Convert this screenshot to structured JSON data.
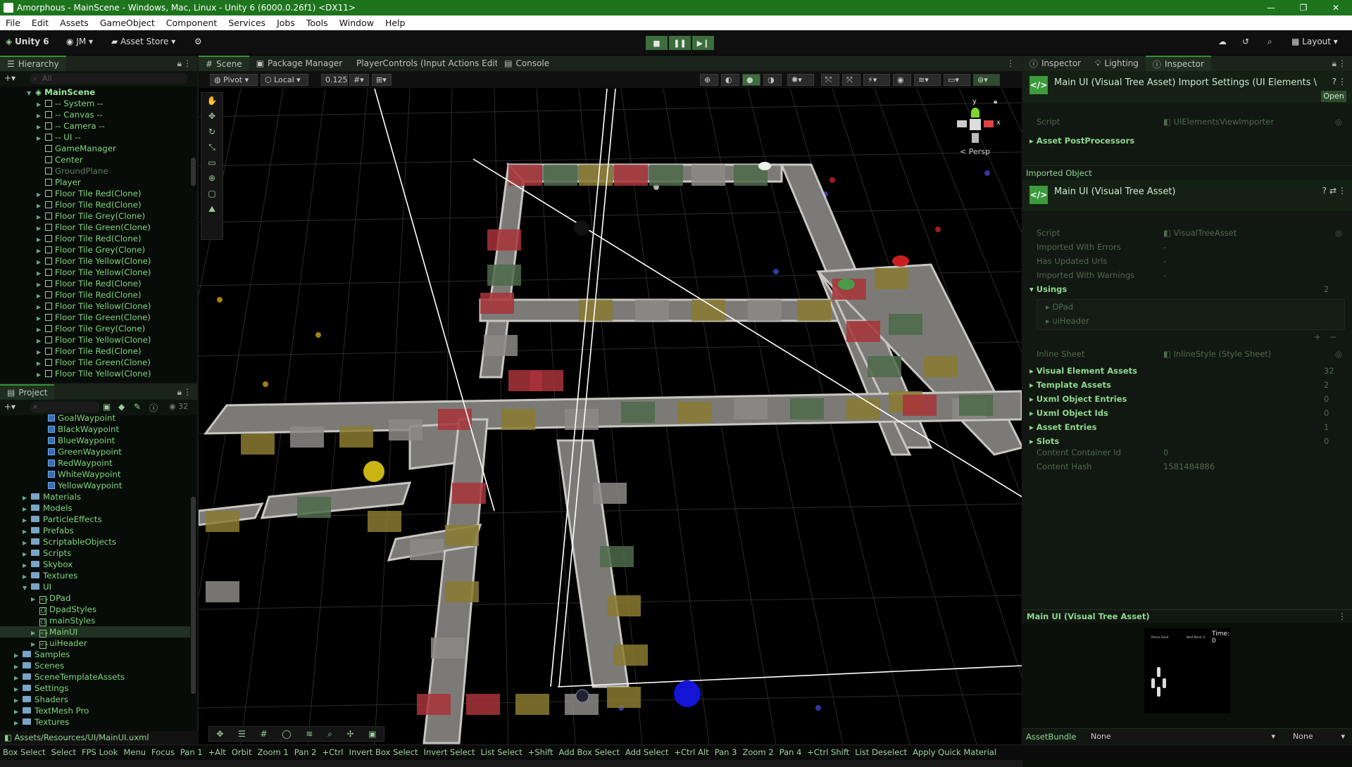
{
  "window": {
    "title": "Amorphous - MainScene - Windows, Mac, Linux - Unity 6 (6000.0.26f1) <DX11>",
    "controls": [
      "—",
      "❐",
      "✕"
    ]
  },
  "menu": [
    "File",
    "Edit",
    "Assets",
    "GameObject",
    "Component",
    "Services",
    "Jobs",
    "Tools",
    "Window",
    "Help"
  ],
  "toolbar": {
    "version": "Unity 6",
    "account": "JM",
    "asset_store": "Asset Store",
    "layout": "Layout"
  },
  "hierarchy": {
    "tab": "Hierarchy",
    "search_placeholder": "All",
    "scene": "MainScene",
    "items": [
      {
        "label": "-- System --",
        "expand": true,
        "dim": false
      },
      {
        "label": "-- Canvas --",
        "expand": true,
        "dim": false
      },
      {
        "label": "-- Camera --",
        "expand": true,
        "dim": false
      },
      {
        "label": "-- UI --",
        "expand": true,
        "dim": false
      },
      {
        "label": "GameManager",
        "expand": false,
        "dim": false
      },
      {
        "label": "Center",
        "expand": false,
        "dim": false
      },
      {
        "label": "GroundPlane",
        "expand": false,
        "dim": true
      },
      {
        "label": "Player",
        "expand": false,
        "dim": false
      },
      {
        "label": "Floor Tile Red(Clone)",
        "expand": true,
        "dim": false
      },
      {
        "label": "Floor Tile Red(Clone)",
        "expand": true,
        "dim": false
      },
      {
        "label": "Floor Tile Grey(Clone)",
        "expand": true,
        "dim": false
      },
      {
        "label": "Floor Tile Green(Clone)",
        "expand": true,
        "dim": false
      },
      {
        "label": "Floor Tile Red(Clone)",
        "expand": true,
        "dim": false
      },
      {
        "label": "Floor Tile Grey(Clone)",
        "expand": true,
        "dim": false
      },
      {
        "label": "Floor Tile Yellow(Clone)",
        "expand": true,
        "dim": false
      },
      {
        "label": "Floor Tile Yellow(Clone)",
        "expand": true,
        "dim": false
      },
      {
        "label": "Floor Tile Red(Clone)",
        "expand": true,
        "dim": false
      },
      {
        "label": "Floor Tile Red(Clone)",
        "expand": true,
        "dim": false
      },
      {
        "label": "Floor Tile Yellow(Clone)",
        "expand": true,
        "dim": false
      },
      {
        "label": "Floor Tile Green(Clone)",
        "expand": true,
        "dim": false
      },
      {
        "label": "Floor Tile Grey(Clone)",
        "expand": true,
        "dim": false
      },
      {
        "label": "Floor Tile Yellow(Clone)",
        "expand": true,
        "dim": false
      },
      {
        "label": "Floor Tile Red(Clone)",
        "expand": true,
        "dim": false
      },
      {
        "label": "Floor Tile Green(Clone)",
        "expand": true,
        "dim": false
      },
      {
        "label": "Floor Tile Yellow(Clone)",
        "expand": true,
        "dim": false
      }
    ]
  },
  "project": {
    "tab": "Project",
    "count": "32",
    "items": [
      {
        "label": "GoalWaypoint",
        "indent": 5,
        "type": "prefab"
      },
      {
        "label": "BlackWaypoint",
        "indent": 5,
        "type": "prefab"
      },
      {
        "label": "BlueWaypoint",
        "indent": 5,
        "type": "prefab"
      },
      {
        "label": "GreenWaypoint",
        "indent": 5,
        "type": "prefab"
      },
      {
        "label": "RedWaypoint",
        "indent": 5,
        "type": "prefab"
      },
      {
        "label": "WhiteWaypoint",
        "indent": 5,
        "type": "prefab"
      },
      {
        "label": "YellowWaypoint",
        "indent": 5,
        "type": "prefab"
      },
      {
        "label": "Materials",
        "indent": 2,
        "type": "folder"
      },
      {
        "label": "Models",
        "indent": 2,
        "type": "folder"
      },
      {
        "label": "ParticleEffects",
        "indent": 2,
        "type": "folder"
      },
      {
        "label": "Prefabs",
        "indent": 2,
        "type": "folder"
      },
      {
        "label": "ScriptableObjects",
        "indent": 2,
        "type": "folder"
      },
      {
        "label": "Scripts",
        "indent": 2,
        "type": "folder"
      },
      {
        "label": "Skybox",
        "indent": 2,
        "type": "folder"
      },
      {
        "label": "Textures",
        "indent": 2,
        "type": "folder"
      },
      {
        "label": "UI",
        "indent": 2,
        "type": "folder-open"
      },
      {
        "label": "DPad",
        "indent": 3,
        "type": "uxml"
      },
      {
        "label": "DpadStyles",
        "indent": 3,
        "type": "uss"
      },
      {
        "label": "mainStyles",
        "indent": 3,
        "type": "uss"
      },
      {
        "label": "MainUI",
        "indent": 3,
        "type": "uxml",
        "selected": true
      },
      {
        "label": "uiHeader",
        "indent": 3,
        "type": "uxml"
      },
      {
        "label": "Samples",
        "indent": 1,
        "type": "folder"
      },
      {
        "label": "Scenes",
        "indent": 1,
        "type": "folder"
      },
      {
        "label": "SceneTemplateAssets",
        "indent": 1,
        "type": "folder"
      },
      {
        "label": "Settings",
        "indent": 1,
        "type": "folder"
      },
      {
        "label": "Shaders",
        "indent": 1,
        "type": "folder"
      },
      {
        "label": "TextMesh Pro",
        "indent": 1,
        "type": "folder"
      },
      {
        "label": "Textures",
        "indent": 1,
        "type": "folder"
      }
    ],
    "path": "Assets/Resources/UI/MainUI.uxml"
  },
  "center_tabs": [
    "Scene",
    "Package Manager",
    "PlayerControls (Input Actions Edit",
    "Console"
  ],
  "scene_toolbar": {
    "pivot": "Pivot",
    "local": "Local",
    "snap": "0.125",
    "persp": "< Persp",
    "gizmo_y": "y",
    "gizmo_x": "x"
  },
  "inspector": {
    "tabs": [
      "Inspector",
      "Lighting",
      "Inspector"
    ],
    "header_title": "Main UI (Visual Tree Asset) Import Settings (UI Elements \\",
    "open": "Open",
    "script1_label": "Script",
    "script1_value": "UIElementsViewImporter",
    "postprocessors": "Asset PostProcessors",
    "imported_object": "Imported Object",
    "object_title": "Main UI (Visual Tree Asset)",
    "script2_label": "Script",
    "script2_value": "VisualTreeAsset",
    "flags": [
      "Imported With Errors",
      "Has Updated Urls",
      "Imported With Warnings"
    ],
    "usings_label": "Usings",
    "usings_count": "2",
    "usings": [
      "DPad",
      "uiHeader"
    ],
    "inline_sheet_label": "Inline Sheet",
    "inline_sheet_value": "InlineStyle (Style Sheet)",
    "fields": [
      {
        "label": "Visual Element Assets",
        "value": "32"
      },
      {
        "label": "Template Assets",
        "value": "2"
      },
      {
        "label": "Uxml Object Entries",
        "value": "0"
      },
      {
        "label": "Uxml Object Ids",
        "value": "0"
      },
      {
        "label": "Asset Entries",
        "value": "1"
      },
      {
        "label": "Slots",
        "value": "0"
      }
    ],
    "container_label": "Content Container Id",
    "container_value": "0",
    "hash_label": "Content Hash",
    "hash_value": "1581484886",
    "preview_title": "Main UI (Visual Tree Asset)",
    "preview_header_left": "Pieces Fixed",
    "preview_header_mid": "Next Move: 0",
    "preview_header_right": "Time: 0",
    "assetbundle_label": "AssetBundle",
    "assetbundle_value": "None",
    "assetbundle_variant": "None"
  },
  "statusbar": [
    "Box Select",
    "Select",
    "FPS Look",
    "Menu",
    "Focus",
    "Pan 1",
    "+Alt",
    "Orbit",
    "Zoom 1",
    "Pan 2",
    "+Ctrl",
    "Invert Box Select",
    "Invert Select",
    "List Select",
    "+Shift",
    "Add Box Select",
    "Add Select",
    "+Ctrl Alt",
    "Pan 3",
    "Zoom 2",
    "Pan 4",
    "+Ctrl Shift",
    "List Deselect",
    "Apply Quick Material"
  ],
  "colors": {
    "accent_green": "#1d741d",
    "tile_red": "#a8343a",
    "tile_green": "#4e6a4a",
    "tile_yellow": "#8a7a30",
    "tile_grey": "#8c8a86"
  }
}
